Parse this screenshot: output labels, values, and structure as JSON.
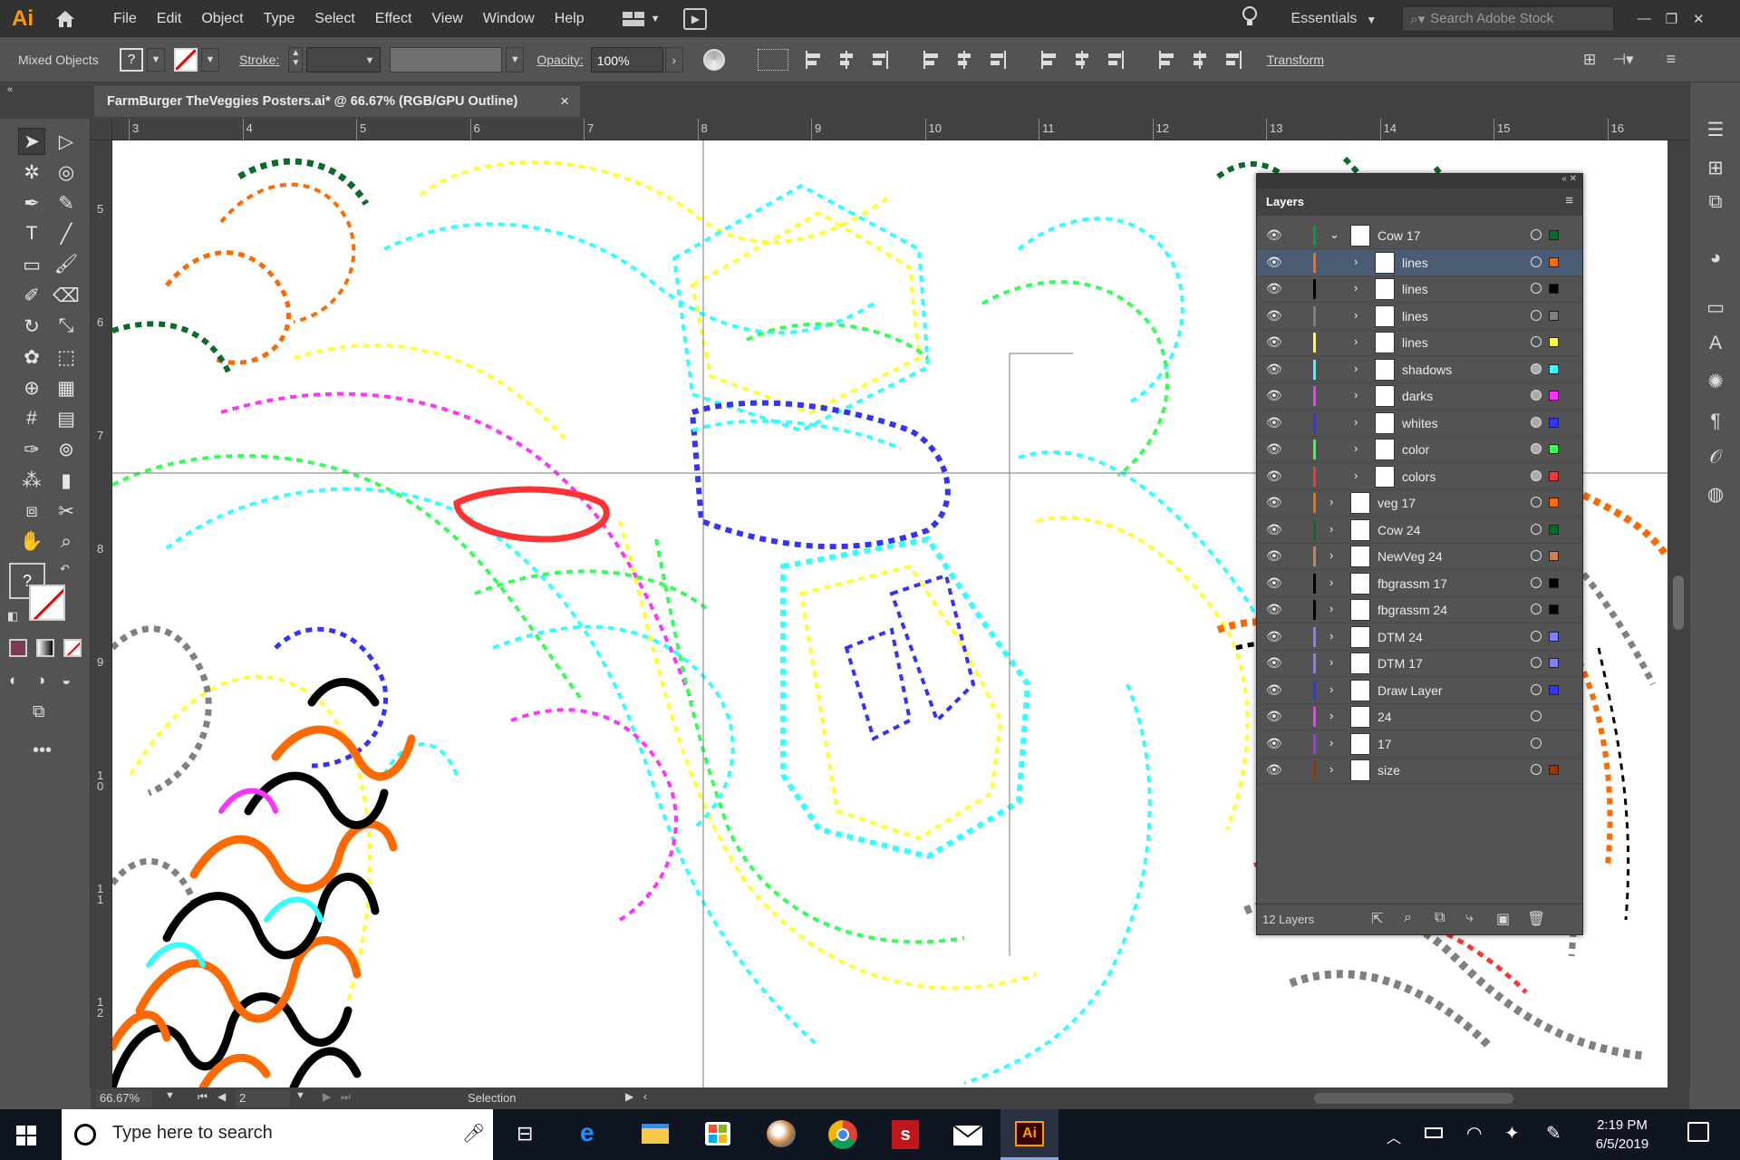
{
  "app": {
    "logo": "Ai"
  },
  "menu": [
    "File",
    "Edit",
    "Object",
    "Type",
    "Select",
    "Effect",
    "View",
    "Window",
    "Help"
  ],
  "workspace": {
    "label": "Essentials",
    "search_placeholder": "Search Adobe Stock"
  },
  "control": {
    "selection": "Mixed Objects",
    "fill_glyph": "?",
    "stroke_label": "Stroke:",
    "opacity_label": "Opacity:",
    "opacity_value": "100%",
    "transform_label": "Transform"
  },
  "document": {
    "tab_title": "FarmBurger TheVeggies Posters.ai* @ 66.67% (RGB/GPU Outline)",
    "close_glyph": "×"
  },
  "ruler": {
    "h": [
      "3",
      "4",
      "5",
      "6",
      "7",
      "8",
      "9",
      "10",
      "11",
      "12",
      "13",
      "14",
      "15",
      "16"
    ],
    "v": [
      "5",
      "6",
      "7",
      "8",
      "9",
      "10",
      "11",
      "12"
    ]
  },
  "status": {
    "zoom": "66.67%",
    "page": "2",
    "tool": "Selection"
  },
  "layers_panel": {
    "title": "Layers",
    "count": "12 Layers",
    "rows": [
      {
        "name": "Cow 17",
        "color": "#00a13a",
        "swatch": "#0a6a2a",
        "level": 0,
        "open": true
      },
      {
        "name": "lines",
        "color": "#ff6a00",
        "swatch": "#ff6a00",
        "level": 1,
        "selected": true
      },
      {
        "name": "lines",
        "color": "#000000",
        "swatch": "#000000",
        "level": 1
      },
      {
        "name": "lines",
        "color": "#808080",
        "swatch": "#808080",
        "level": 1
      },
      {
        "name": "lines",
        "color": "#ffff33",
        "swatch": "#ffff33",
        "level": 1
      },
      {
        "name": "shadows",
        "color": "#33ffff",
        "swatch": "#33ffff",
        "level": 1
      },
      {
        "name": "darks",
        "color": "#ff33ff",
        "swatch": "#ff33ff",
        "level": 1
      },
      {
        "name": "whites",
        "color": "#3333ff",
        "swatch": "#3333ff",
        "level": 1
      },
      {
        "name": "color",
        "color": "#33ff55",
        "swatch": "#33ff55",
        "level": 1
      },
      {
        "name": "colors",
        "color": "#ff3333",
        "swatch": "#ff3333",
        "level": 1
      },
      {
        "name": "veg 17",
        "color": "#ff6a00",
        "swatch": "#ff6a00",
        "level": 0
      },
      {
        "name": "Cow 24",
        "color": "#0a6a2a",
        "swatch": "#0a6a2a",
        "level": 0
      },
      {
        "name": "NewVeg 24",
        "color": "#d08050",
        "swatch": "#d08050",
        "level": 0
      },
      {
        "name": "fbgrassm 17",
        "color": "#000000",
        "swatch": "#000000",
        "level": 0
      },
      {
        "name": "fbgrassm 24",
        "color": "#000000",
        "swatch": "#000000",
        "level": 0
      },
      {
        "name": "DTM 24",
        "color": "#8080ff",
        "swatch": "#8080ff",
        "level": 0
      },
      {
        "name": "DTM 17",
        "color": "#8080ff",
        "swatch": "#8080ff",
        "level": 0
      },
      {
        "name": "Draw Layer",
        "color": "#3333ff",
        "swatch": "#3333ff",
        "level": 0
      },
      {
        "name": "24",
        "color": "#ff33ff",
        "swatch": "",
        "level": 0
      },
      {
        "name": "17",
        "color": "#a033ff",
        "swatch": "",
        "level": 0
      },
      {
        "name": "size",
        "color": "#a03300",
        "swatch": "#a03300",
        "level": 0
      }
    ]
  },
  "taskbar": {
    "search_placeholder": "Type here to search",
    "time": "2:19 PM",
    "date": "6/5/2019"
  }
}
